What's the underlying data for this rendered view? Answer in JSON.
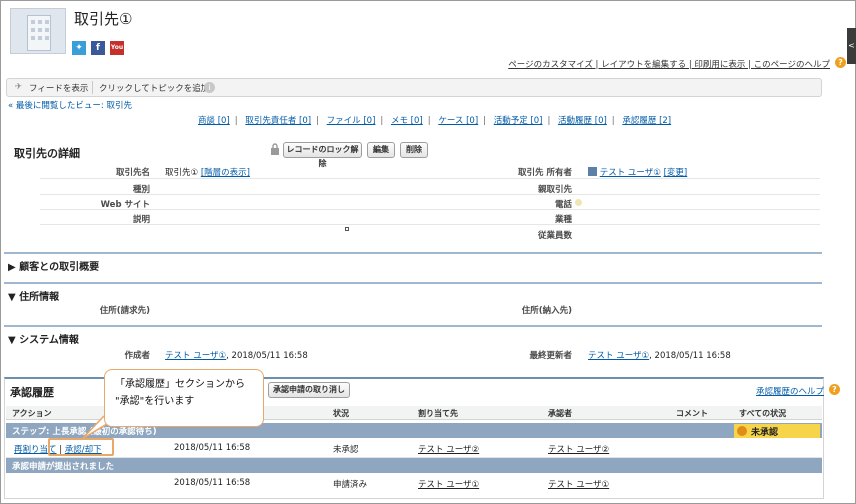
{
  "header": {
    "title": "取引先①",
    "social": {
      "twitter": "twitter-icon",
      "facebook": "f",
      "youtube": "You Tube"
    },
    "top_links": "ページのカスタマイズ | レイアウトを編集する | 印刷用に表示 | このページのヘルプ",
    "help_icon": "?",
    "side_tab": "<"
  },
  "feedbar": {
    "show_feed": "フィードを表示",
    "add_topic": "クリックしてトピックを追加"
  },
  "breadcrumb": "« 最後に閲覧したビュー: 取引先",
  "related_links": [
    "商談 [0]",
    "取引先責任者 [0]",
    "ファイル [0]",
    "メモ [0]",
    "ケース [0]",
    "活動予定 [0]",
    "活動履歴 [0]",
    "承認履歴 [2]"
  ],
  "detail": {
    "section_title": "取引先の詳細",
    "buttons": {
      "unlock": "レコードのロック解除",
      "edit": "編集",
      "delete": "削除"
    },
    "left": [
      {
        "label": "取引先名",
        "value": "取引先① [階層の表示]"
      },
      {
        "label": "種別",
        "value": ""
      },
      {
        "label": "Web サイト",
        "value": ""
      },
      {
        "label": "説明",
        "value": ""
      }
    ],
    "right": [
      {
        "label": "取引先 所有者",
        "value": "テスト ユーザ① [変更]"
      },
      {
        "label": "親取引先",
        "value": ""
      },
      {
        "label": "電話",
        "value": ""
      },
      {
        "label": "業種",
        "value": ""
      },
      {
        "label": "従業員数",
        "value": ""
      }
    ]
  },
  "sections": {
    "summary": "▶ 顧客との取引概要",
    "address": "▼ 住所情報",
    "billing": "住所(請求先)",
    "shipping": "住所(納入先)",
    "system": "▼ システム情報",
    "created_by_label": "作成者",
    "created_by_user": "テスト ユーザ①",
    "created_by_date": ", 2018/05/11 16:58",
    "modified_by_label": "最終更新者",
    "modified_by_user": "テスト ユーザ①",
    "modified_by_date": ", 2018/05/11 16:58"
  },
  "approval": {
    "title": "承認履歴",
    "recall_button": "承認申請の取り消し",
    "help_link": "承認履歴のヘルプ",
    "help_icon": "?",
    "columns": {
      "action": "アクション",
      "status": "状況",
      "assignee": "割り当て先",
      "approver": "承認者",
      "comment": "コメント",
      "overall": "すべての状況"
    },
    "step1": "ステップ: 上長承認 (最初の承認待ち)",
    "pending_badge": "未承認",
    "row1": {
      "reassign": "再割り当て",
      "approve": "承認/却下",
      "date": "2018/05/11 16:58",
      "status": "未承認",
      "assignee": "テスト ユーザ②",
      "approver": "テスト ユーザ②"
    },
    "step2": "承認申請が提出されました",
    "row2": {
      "date": "2018/05/11 16:58",
      "status": "申請済み",
      "assignee": "テスト ユーザ①",
      "approver": "テスト ユーザ①"
    }
  },
  "callout": {
    "line1": "「承認履歴」セクションから",
    "line2": "\"承認\"を行います"
  }
}
